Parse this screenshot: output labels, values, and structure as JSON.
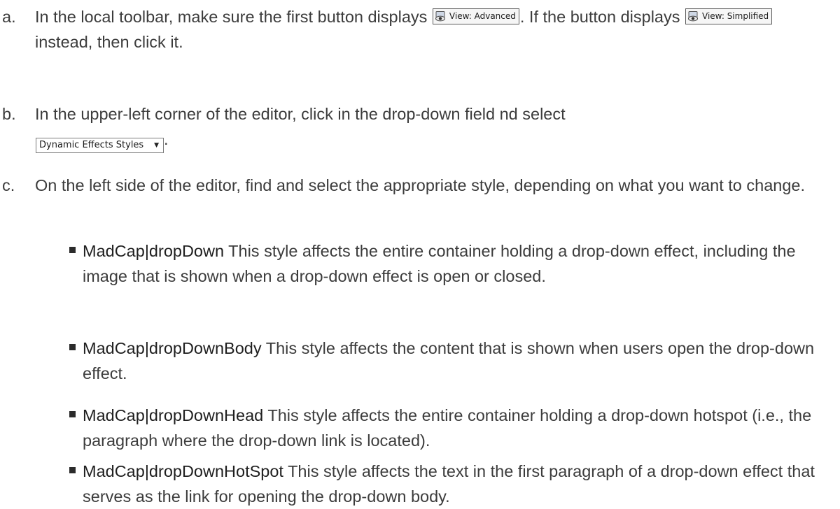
{
  "steps": [
    {
      "marker": "a.",
      "text_before": "In the local toolbar, make sure the first button displays",
      "button_primary": "View: Advanced",
      "text_middle": ". If the button displays",
      "button_secondary": "View: Simplified",
      "text_after": " instead, then click it."
    },
    {
      "marker": "b.",
      "text_before": "In the upper-left corner of the editor, click in the drop-down field  nd select",
      "select_value": "Dynamic Effects Styles",
      "text_after": "."
    },
    {
      "marker": "c.",
      "text": "On the left side of the editor, find and select the appropriate style, depending on what you want to change."
    }
  ],
  "styles": [
    {
      "term": "MadCap|dropDown",
      "description": " This style affects the entire container holding a drop-down effect, including the image that is shown when a drop-down effect is open or closed."
    },
    {
      "term": "MadCap|dropDownBody",
      "description": " This style affects the content that is shown when users open the drop-down effect."
    },
    {
      "term": "MadCap|dropDownHead",
      "description": " This style affects the entire container holding a drop-down hotspot (i.e., the paragraph where the drop-down link is located)."
    },
    {
      "term": "MadCap|dropDownHotSpot",
      "description": " This style affects the text in the first paragraph of a drop-down effect that serves as the link for opening the drop-down body."
    }
  ],
  "icons": {
    "view_button_icon": "eye-display-icon",
    "select_arrow_icon": "dropdown-arrow-icon"
  }
}
